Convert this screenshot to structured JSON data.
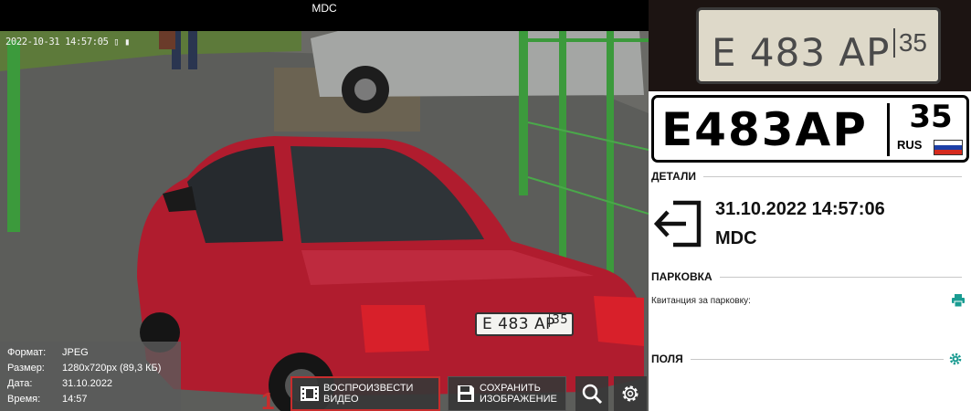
{
  "viewer": {
    "title": "MDC",
    "timestamp": "2022-10-31 14:57:05 ▯ ▮",
    "plate_on_car": {
      "number": "E 483 AP",
      "region": "35"
    }
  },
  "info": {
    "rows": [
      {
        "label": "Формат:",
        "value": "JPEG"
      },
      {
        "label": "Размер:",
        "value": "1280x720px (89,3 КБ)"
      },
      {
        "label": "Дата:",
        "value": "31.10.2022"
      },
      {
        "label": "Время:",
        "value": "14:57"
      }
    ]
  },
  "toolbar": {
    "play_line1": "ВОСПРОИЗВЕСТИ",
    "play_line2": "ВИДЕО",
    "save_line1": "СОХРАНИТЬ",
    "save_line2": "ИЗОБРАЖЕНИЕ",
    "marker": "1"
  },
  "panel": {
    "crop_plate": {
      "number": "E 483 AP",
      "region": "35"
    },
    "plate": {
      "number": "E483AP",
      "region": "35",
      "country": "RUS"
    },
    "details": {
      "heading": "ДЕТАЛИ",
      "datetime": "31.10.2022 14:57:06",
      "camera": "MDC",
      "direction_icon": "entry-arrow-icon"
    },
    "parking": {
      "heading": "ПАРКОВКА",
      "ticket_label": "Квитанция за парковку:",
      "print_icon": "printer-icon"
    },
    "fields": {
      "heading": "ПОЛЯ",
      "settings_icon": "gear-icon"
    }
  },
  "colors": {
    "accent_teal": "#1a9c92",
    "highlight_red": "#c82d2d",
    "car_red": "#b01c2e"
  }
}
